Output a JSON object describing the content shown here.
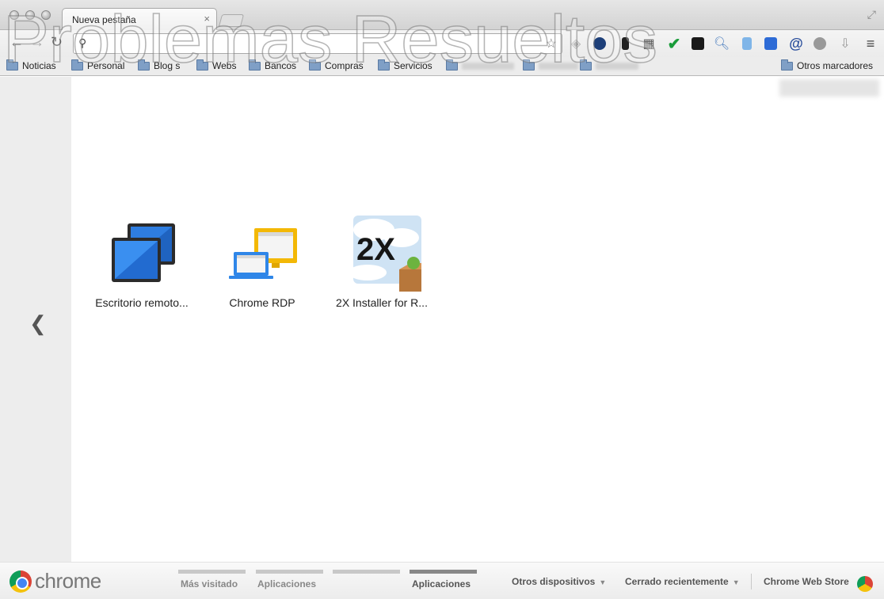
{
  "tab": {
    "title": "Nueva pestaña",
    "close": "×"
  },
  "omnibox": {
    "value": "",
    "placeholder": ""
  },
  "watermark": "Problemas Resueltos",
  "bookmarks": [
    {
      "label": "Noticias"
    },
    {
      "label": "Personal"
    },
    {
      "label": "Blog s"
    },
    {
      "label": "Webs"
    },
    {
      "label": "Bancos"
    },
    {
      "label": "Compras"
    },
    {
      "label": "Servicios"
    }
  ],
  "other_bookmarks": "Otros marcadores",
  "apps": [
    {
      "label": "Escritorio remoto...",
      "icon": "remote-desktop-icon"
    },
    {
      "label": "Chrome RDP",
      "icon": "chrome-rdp-icon"
    },
    {
      "label": "2X Installer for R...",
      "icon": "2x-installer-icon",
      "badge": "2X"
    }
  ],
  "footer": {
    "brand": "chrome",
    "pages": [
      "Más visitado",
      "Aplicaciones",
      "",
      "Aplicaciones"
    ],
    "active_page": 3,
    "other_devices": "Otros dispositivos",
    "recently_closed": "Cerrado recientemente",
    "web_store": "Chrome Web Store"
  },
  "extensions": [
    "globe-icon",
    "phone-icon",
    "grid-icon",
    "check-icon",
    "network-icon",
    "magnifier-icon",
    "page-icon",
    "screen-icon",
    "at-icon",
    "film-icon",
    "download-icon",
    "menu-icon"
  ],
  "colors": {
    "folder": "#7f9fc6",
    "accent_blue": "#2d6bd6",
    "check_green": "#1a9c3a"
  }
}
